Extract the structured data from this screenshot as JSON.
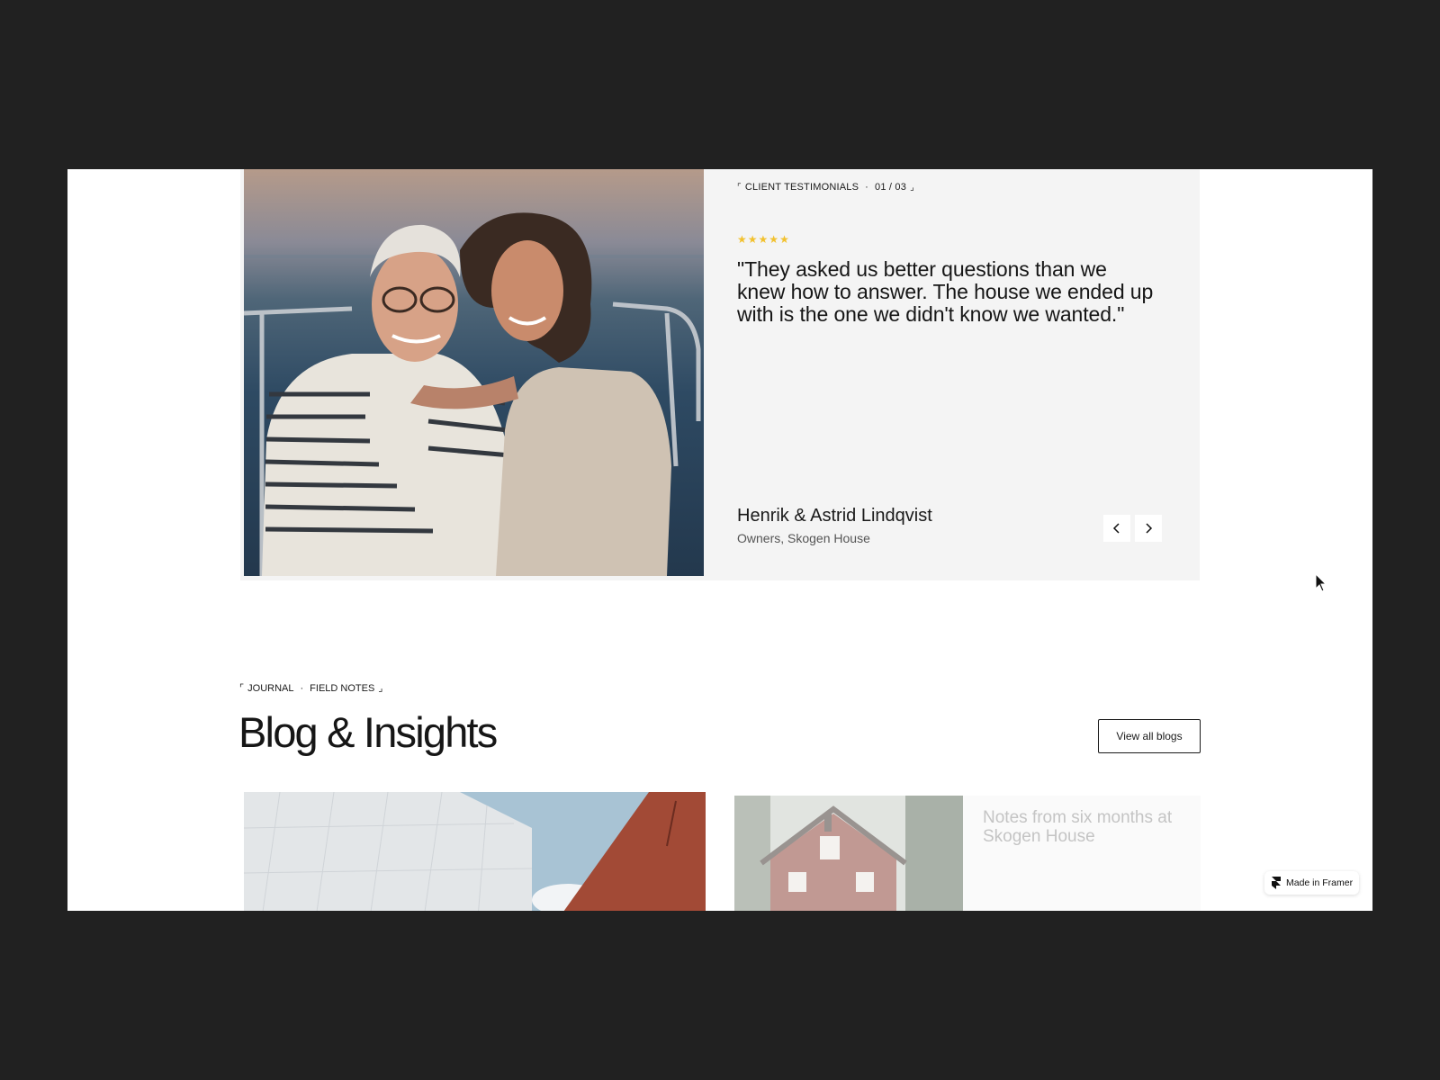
{
  "testimonial": {
    "eyebrow_label": "CLIENT TESTIMONIALS",
    "eyebrow_separator": "·",
    "counter": "01 / 03",
    "rating": 5,
    "quote": "\"They asked us better questions than we knew how to answer. The house we ended up with is the one we didn't know we wanted.\"",
    "author_name": "Henrik & Astrid Lindqvist",
    "author_role": "Owners, Skogen House",
    "prev_icon": "chevron-left-icon",
    "next_icon": "chevron-right-icon",
    "star_color": "#f2c12e"
  },
  "blog": {
    "eyebrow_part1": "JOURNAL",
    "eyebrow_separator": "·",
    "eyebrow_part2": "FIELD NOTES",
    "title": "Blog & Insights",
    "view_all_label": "View all blogs",
    "posts": [
      {
        "title": ""
      },
      {
        "title": "Notes from six months at Skogen House"
      }
    ]
  },
  "badge": {
    "label": "Made in Framer",
    "icon": "framer-logo-icon"
  },
  "colors": {
    "page_background": "#212121",
    "content_background": "#ffffff",
    "card_background": "#f4f4f4"
  }
}
